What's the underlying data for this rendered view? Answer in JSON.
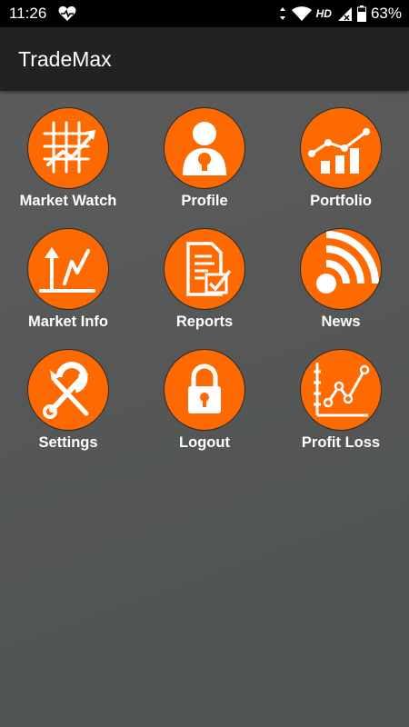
{
  "status_bar": {
    "time": "11:26",
    "network": "HD",
    "battery": "63%",
    "icons": [
      "heart-icon",
      "vibrate-icon",
      "wifi-icon",
      "signal-icon",
      "battery-icon"
    ]
  },
  "app_bar": {
    "title": "TradeMax"
  },
  "menu": {
    "accent_color": "#ff6a00",
    "items": [
      {
        "label": "Market Watch",
        "icon": "market-watch-icon"
      },
      {
        "label": "Profile",
        "icon": "profile-icon"
      },
      {
        "label": "Portfolio",
        "icon": "portfolio-icon"
      },
      {
        "label": "Market Info",
        "icon": "market-info-icon"
      },
      {
        "label": "Reports",
        "icon": "reports-icon"
      },
      {
        "label": "News",
        "icon": "news-icon"
      },
      {
        "label": "Settings",
        "icon": "settings-icon"
      },
      {
        "label": "Logout",
        "icon": "logout-icon"
      },
      {
        "label": "Profit Loss",
        "icon": "profit-loss-icon"
      }
    ]
  }
}
